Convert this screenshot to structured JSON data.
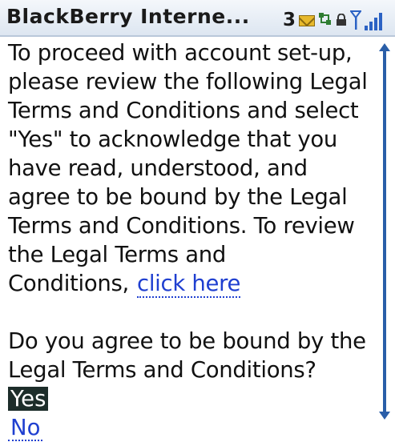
{
  "titlebar": {
    "app_title": "BlackBerry Interne...",
    "message_count": "3",
    "icons": [
      "mail-icon",
      "network-icon",
      "lock-icon",
      "antenna-icon",
      "signal-icon"
    ]
  },
  "content": {
    "intro_text": "To proceed with account set-up, please review the following Legal Terms and Conditions and select \"Yes\" to acknowledge that you have read, understood, and agree to be bound by the Legal Terms and Conditions. To review the Legal Terms and Conditions,",
    "link_label": "click here",
    "question": "Do you agree to be bound by the Legal Terms and Conditions?",
    "option_yes": "Yes",
    "option_no": "No"
  },
  "colors": {
    "link": "#1f3fd0",
    "selection_bg": "#1d2d2a",
    "scrollbar": "#2a5ea8",
    "signal": "#2b62c4"
  }
}
